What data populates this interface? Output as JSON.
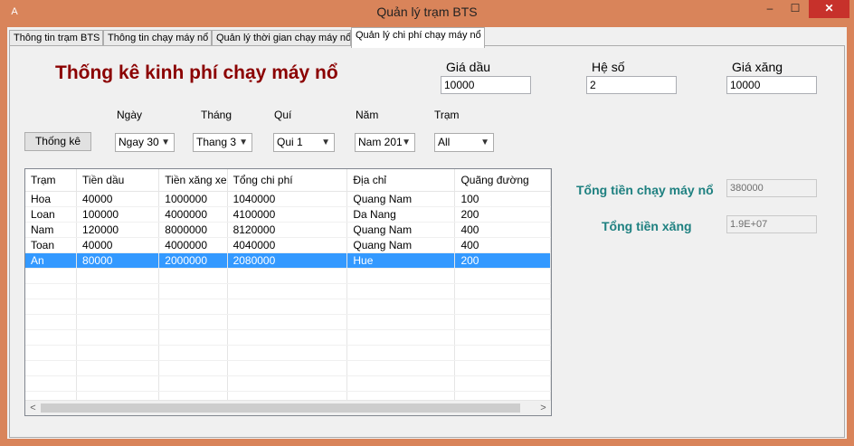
{
  "window": {
    "title": "Quản lý trạm BTS",
    "minimize": "–",
    "maximize": "☐",
    "close": "✕",
    "app_icon": "A"
  },
  "tabs": [
    {
      "label": "Thông tin trạm BTS",
      "active": false
    },
    {
      "label": "Thông tin chạy máy nổ",
      "active": false
    },
    {
      "label": "Quản lý thời gian chạy máy nổ",
      "active": false
    },
    {
      "label": "Quản lý chi phí chạy máy nổ",
      "active": true
    }
  ],
  "page": {
    "heading": "Thống kê kinh phí chạy máy nổ",
    "oil_price_label": "Giá dầu",
    "oil_price_value": "10000",
    "coef_label": "Hệ số",
    "coef_value": "2",
    "gas_price_label": "Giá xăng",
    "gas_price_value": "10000",
    "stats_button": "Thống kê"
  },
  "filters": {
    "day": {
      "label": "Ngày",
      "value": "Ngay 30"
    },
    "month": {
      "label": "Tháng",
      "value": "Thang 3"
    },
    "quarter": {
      "label": "Quí",
      "value": "Qui 1"
    },
    "year": {
      "label": "Năm",
      "value": "Nam 201"
    },
    "station": {
      "label": "Trạm",
      "value": "All"
    }
  },
  "grid": {
    "columns": [
      "Trạm",
      "Tiền dầu",
      "Tiền xăng xe",
      "Tổng chi phí",
      "Địa chỉ",
      "Quãng đường"
    ],
    "rows": [
      [
        "Hoa",
        "40000",
        "1000000",
        "1040000",
        "Quang Nam",
        "100"
      ],
      [
        "Loan",
        "100000",
        "4000000",
        "4100000",
        "Da Nang",
        "200"
      ],
      [
        "Nam",
        "120000",
        "8000000",
        "8120000",
        "Quang Nam",
        "400"
      ],
      [
        "Toan",
        "40000",
        "4000000",
        "4040000",
        "Quang Nam",
        "400"
      ],
      [
        "An",
        "80000",
        "2000000",
        "2080000",
        "Hue",
        "200"
      ]
    ],
    "selected_row": 4,
    "scroll_left": "<",
    "scroll_right": ">"
  },
  "totals": {
    "generator_label": "Tổng tiền chạy máy nổ",
    "generator_value": "380000",
    "gas_label": "Tổng tiền xăng",
    "gas_value": "1.9E+07"
  },
  "colors": {
    "frame": "#d9845a",
    "heading": "#8b0000",
    "totals_label": "#1e8080",
    "selection": "#3399ff"
  }
}
